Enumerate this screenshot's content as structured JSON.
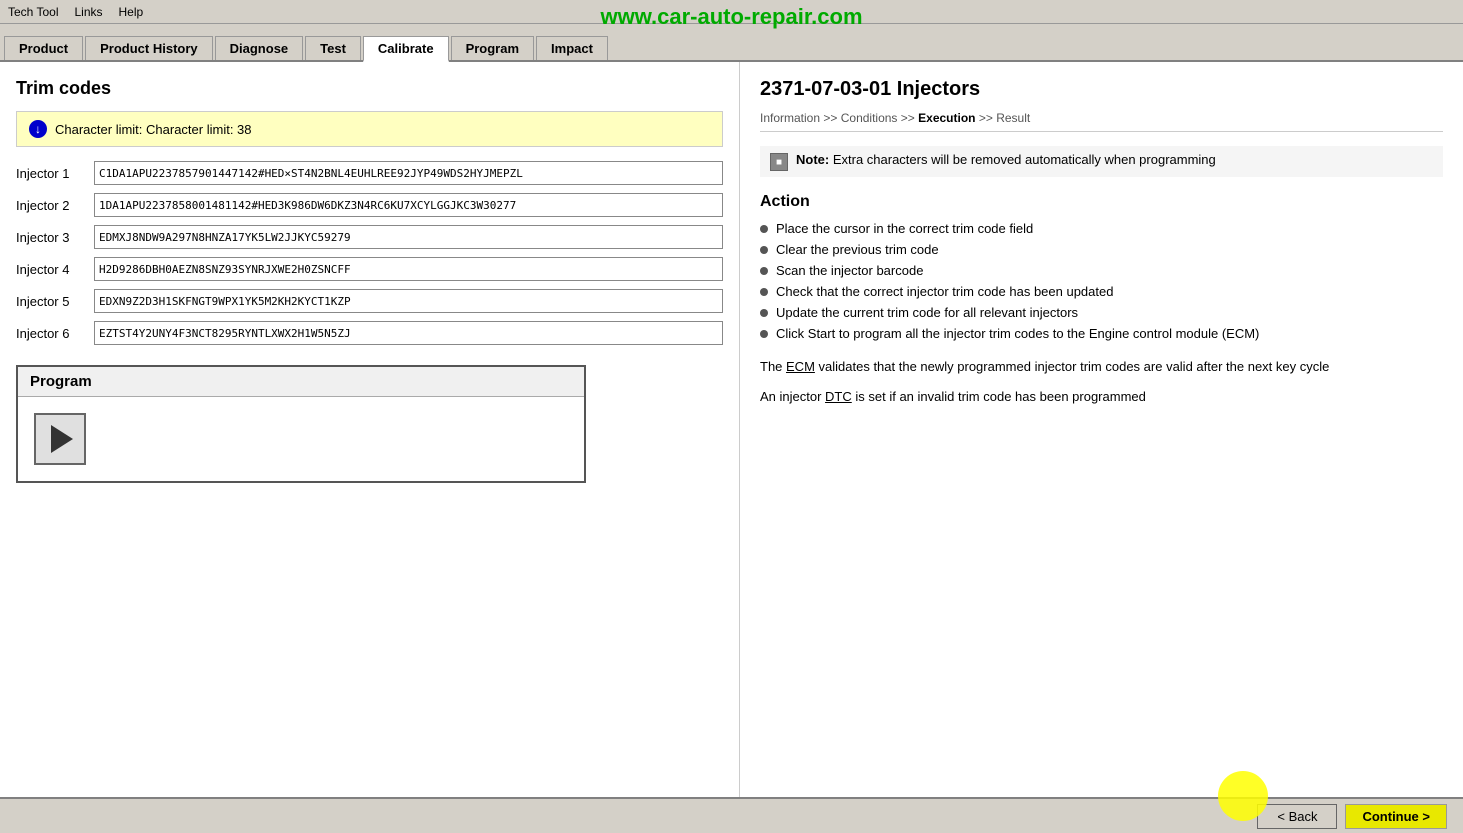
{
  "menubar": {
    "items": [
      "Tech Tool",
      "Links",
      "Help"
    ]
  },
  "watermark": "www.car-auto-repair.com",
  "nav": {
    "tabs": [
      {
        "label": "Product",
        "active": false
      },
      {
        "label": "Product History",
        "active": false
      },
      {
        "label": "Diagnose",
        "active": false
      },
      {
        "label": "Test",
        "active": false
      },
      {
        "label": "Calibrate",
        "active": true
      },
      {
        "label": "Program",
        "active": false
      },
      {
        "label": "Impact",
        "active": false
      }
    ]
  },
  "left": {
    "title": "Trim codes",
    "alert": {
      "icon": "↓",
      "text": "Character limit: Character limit: 38"
    },
    "injectors": [
      {
        "label": "Injector 1",
        "value": "C1DA1APU2237857901447142#HED×ST4N2BNL4EUHLREE92JYP49WDS2HYJMEPZL"
      },
      {
        "label": "Injector 2",
        "value": "1DA1APU2237858001481142#HED3K986DW6DKZ3N4RC6KU7XCYLGGJKC3W30277"
      },
      {
        "label": "Injector 3",
        "value": "EDMXJ8NDW9A297N8HNZA17YK5LW2JJKYC59279"
      },
      {
        "label": "Injector 4",
        "value": "H2D9286DBH0AEZN8SNZ93SYNRJXWE2H0ZSNCFF"
      },
      {
        "label": "Injector 5",
        "value": "EDXN9Z2D3H1SKFNGT9WPX1YK5M2KH2KYCT1KZP"
      },
      {
        "label": "Injector 6",
        "value": "EZTST4Y2UNY4F3NCT8295RYNTLXWX2H1W5N5ZJ"
      }
    ],
    "program_label": "Program"
  },
  "right": {
    "title": "2371-07-03-01 Injectors",
    "breadcrumb": {
      "items": [
        "Information",
        "Conditions",
        "Execution",
        "Result"
      ],
      "active_index": 2
    },
    "note": "Note: Extra characters will be removed automatically when programming",
    "action_title": "Action",
    "action_items": [
      "Place the cursor in the correct trim code field",
      "Clear the previous trim code",
      "Scan the injector barcode",
      "Check that the correct injector trim code has been updated",
      "Update the current trim code for all relevant injectors",
      "Click Start to program all the injector trim codes to the Engine control module (ECM)"
    ],
    "info1": "The ECM validates that the newly programmed injector trim codes are valid after the next key cycle",
    "info1_link": "ECM",
    "info2": "An injector DTC is set if an invalid trim code has been programmed",
    "info2_link": "DTC"
  },
  "footer": {
    "back_label": "< Back",
    "continue_label": "Continue >"
  }
}
